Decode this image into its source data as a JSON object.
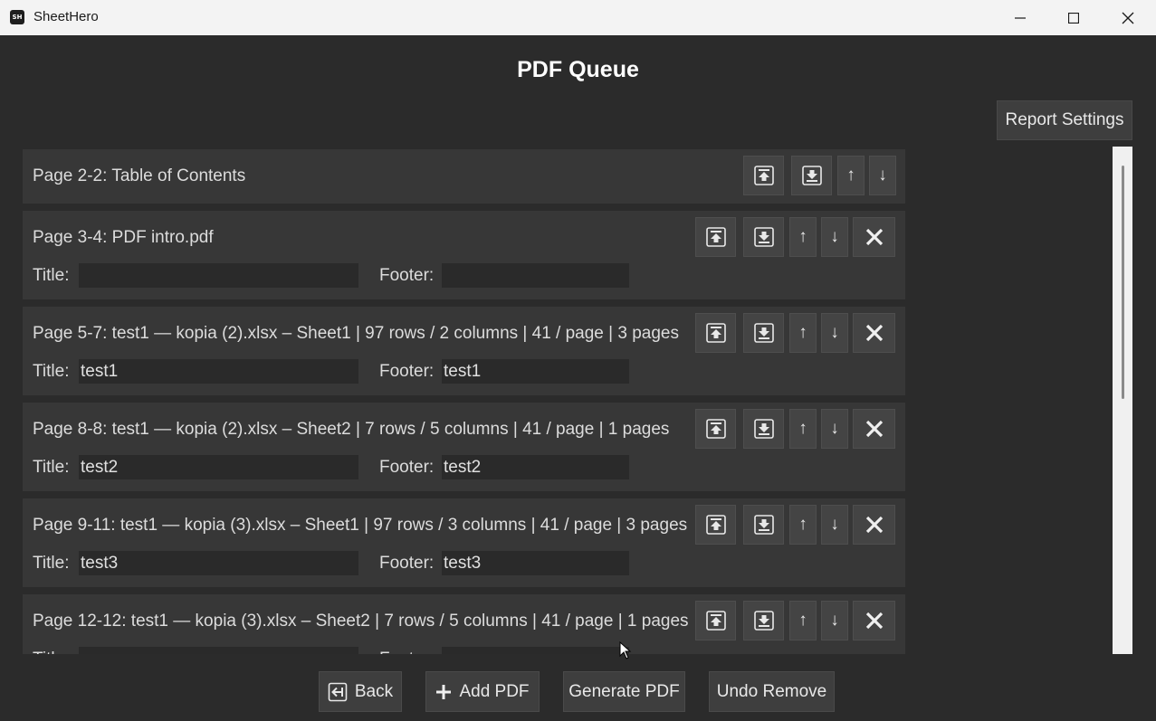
{
  "window": {
    "title": "SheetHero",
    "icon_text": "SH"
  },
  "page_title": "PDF Queue",
  "report_settings_label": "Report Settings",
  "field_labels": {
    "title": "Title:",
    "footer": "Footer:"
  },
  "items": [
    {
      "label": "Page 2-2: Table of Contents"
    },
    {
      "label": "Page 3-4: PDF intro.pdf",
      "title": "",
      "footer": ""
    },
    {
      "label": "Page 5-7: test1 — kopia (2).xlsx – Sheet1 | 97 rows / 2 columns | 41 / page | 3 pages",
      "title": "test1",
      "footer": "test1"
    },
    {
      "label": "Page 8-8: test1 — kopia (2).xlsx – Sheet2 | 7 rows / 5 columns | 41 / page | 1 pages",
      "title": "test2",
      "footer": "test2"
    },
    {
      "label": "Page 9-11: test1 — kopia (3).xlsx – Sheet1 | 97 rows / 3 columns | 41 / page | 3 pages",
      "title": "test3",
      "footer": "test3"
    },
    {
      "label": "Page 12-12: test1 — kopia (3).xlsx – Sheet2 | 7 rows / 5 columns | 41 / page | 1 pages",
      "title": "",
      "footer": ""
    }
  ],
  "move_buttons": {
    "up": "↑",
    "down": "↓"
  },
  "bottom": {
    "back": "Back",
    "add_pdf": "Add PDF",
    "generate_pdf": "Generate PDF",
    "undo_remove": "Undo Remove"
  }
}
